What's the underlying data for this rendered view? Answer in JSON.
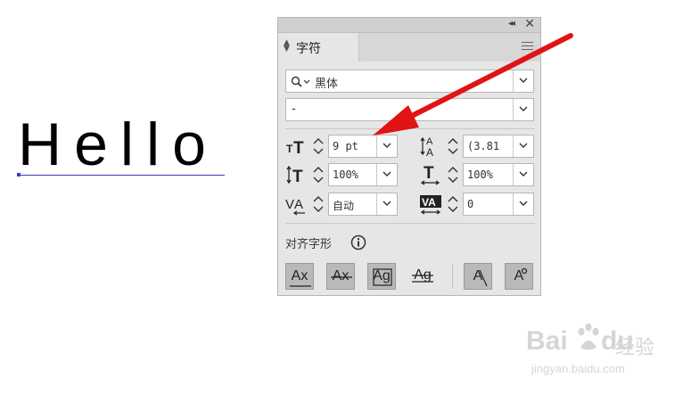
{
  "canvas": {
    "text": "Hello"
  },
  "panel": {
    "tab_label": "字符",
    "font_family": "黑体",
    "font_style": "-",
    "font_size": "9 pt",
    "leading": "(3.81",
    "vertical_scale": "100%",
    "horizontal_scale": "100%",
    "kerning": "自动",
    "tracking": "0",
    "align_glyphs_label": "对齐字形",
    "glyph_buttons": [
      {
        "label": "Ax",
        "active": true
      },
      {
        "label": "Ax",
        "active": true
      },
      {
        "label": "Ag",
        "active": true
      },
      {
        "label": "Ag",
        "active": false
      },
      {
        "label": "A",
        "active": true
      },
      {
        "label": "A",
        "active": true
      }
    ]
  },
  "watermark": {
    "brand": "Bai",
    "brand2": "du",
    "cn": "经验",
    "url": "jingyan.baidu.com"
  },
  "colors": {
    "arrow": "#e01414",
    "panel_bg": "#e6e6e6",
    "button_active": "#b9b9b9"
  },
  "icons": [
    "collapse-icon",
    "close-icon",
    "menu-icon",
    "search-icon",
    "font-size-icon",
    "leading-icon",
    "vertical-scale-icon",
    "horizontal-scale-icon",
    "kerning-icon",
    "tracking-icon",
    "info-icon"
  ]
}
